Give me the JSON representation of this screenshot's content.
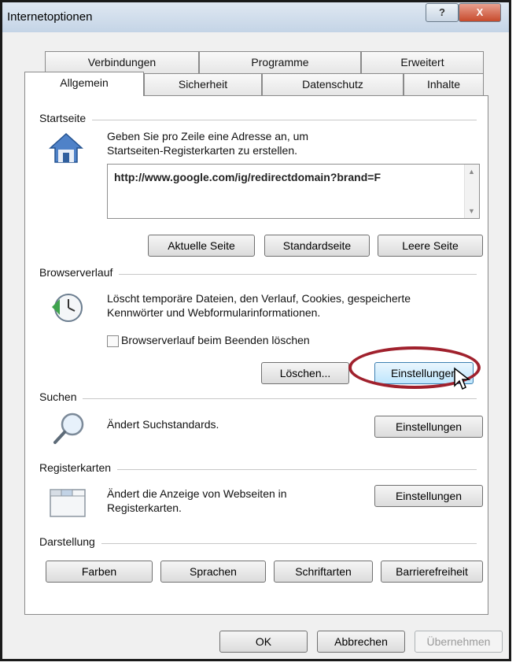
{
  "window": {
    "title": "Internetoptionen",
    "help_label": "?",
    "close_label": "X"
  },
  "tabs": {
    "row1": [
      "Verbindungen",
      "Programme",
      "Erweitert"
    ],
    "row2": [
      "Allgemein",
      "Sicherheit",
      "Datenschutz",
      "Inhalte"
    ],
    "active": "Allgemein"
  },
  "startseite": {
    "label": "Startseite",
    "description_line1": "Geben Sie pro Zeile eine Adresse an, um",
    "description_line2": "Startseiten-Registerkarten zu erstellen.",
    "url_value": "http://www.google.com/ig/redirectdomain?brand=F",
    "buttons": {
      "current": "Aktuelle Seite",
      "default": "Standardseite",
      "blank": "Leere Seite"
    }
  },
  "browserverlauf": {
    "label": "Browserverlauf",
    "description_line1": "Löscht temporäre Dateien, den Verlauf, Cookies, gespeicherte",
    "description_line2": "Kennwörter und Webformularinformationen.",
    "checkbox_label": "Browserverlauf beim Beenden löschen",
    "checkbox_checked": false,
    "delete_button": "Löschen...",
    "settings_button": "Einstellungen"
  },
  "suchen": {
    "label": "Suchen",
    "description": "Ändert Suchstandards.",
    "settings_button": "Einstellungen"
  },
  "registerkarten": {
    "label": "Registerkarten",
    "description_line1": "Ändert die Anzeige von Webseiten in",
    "description_line2": "Registerkarten.",
    "settings_button": "Einstellungen"
  },
  "darstellung": {
    "label": "Darstellung",
    "buttons": {
      "colors": "Farben",
      "languages": "Sprachen",
      "fonts": "Schriftarten",
      "accessibility": "Barrierefreiheit"
    }
  },
  "footer": {
    "ok": "OK",
    "cancel": "Abbrechen",
    "apply": "Übernehmen"
  },
  "icons": {
    "home": "house-icon",
    "history": "clock-history-icon",
    "search": "magnifier-icon",
    "tabs": "tabs-window-icon",
    "cursor": "mouse-pointer-icon"
  },
  "colors": {
    "highlight_circle": "#a0212d",
    "hover_button": "#bee6fd"
  }
}
